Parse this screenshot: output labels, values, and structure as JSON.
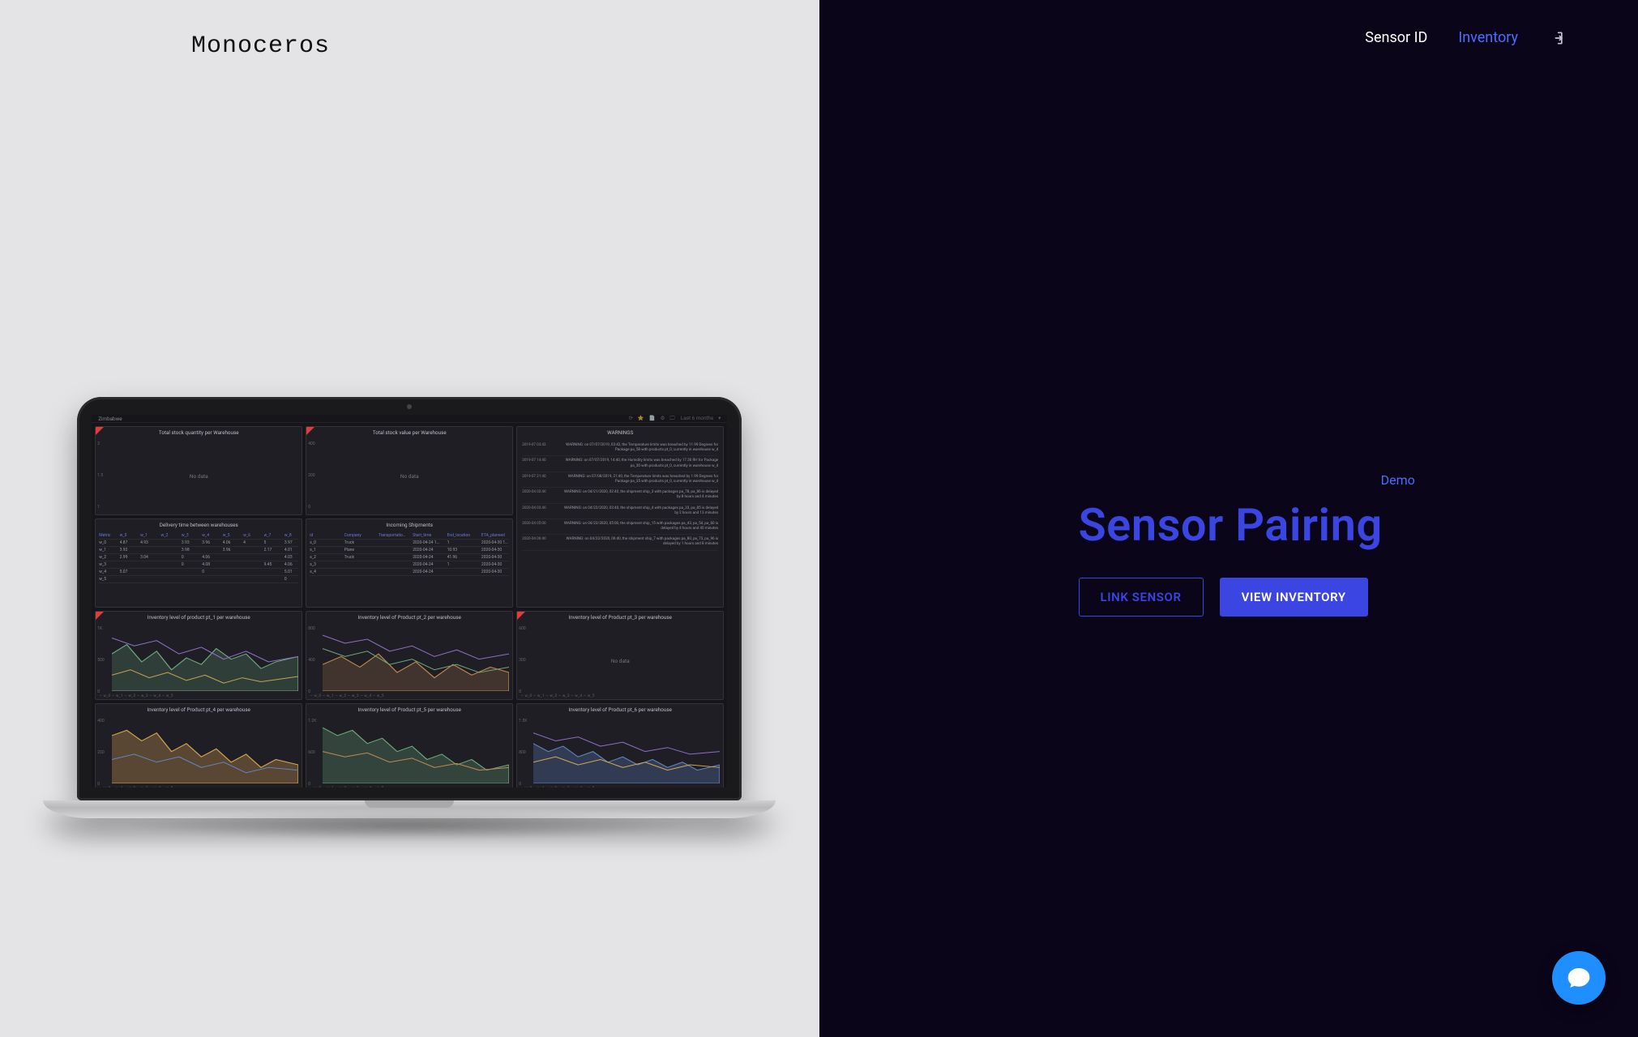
{
  "brand": "Monoceros",
  "nav": {
    "sensor_id": "Sensor ID",
    "inventory": "Inventory"
  },
  "hero": {
    "demo": "Demo",
    "title": "Sensor Pairing",
    "link_sensor": "LINK SENSOR",
    "view_inventory": "VIEW INVENTORY"
  },
  "dashboard": {
    "topbar": {
      "title": "Zimbabwe",
      "timerange": "Last 6 months"
    },
    "no_data_label": "No data",
    "cards": {
      "stock_qty": "Total stock quantity per Warehouse",
      "stock_value": "Total stock value per Warehouse",
      "warnings": "WARNINGS",
      "delivery": "Delivery time between warehouses",
      "incoming": "Incoming Shipments",
      "inv_a1": "Inventory level of product pt_1 per warehouse",
      "inv_a2": "Inventory level of Product pt_2 per warehouse",
      "inv_a3": "Inventory level of Product pt_3 per warehouse",
      "inv_b1": "Inventory level of Product pt_4 per warehouse",
      "inv_b2": "Inventory level of Product pt_5 per warehouse",
      "inv_b3": "Inventory level of Product pt_6 per warehouse"
    },
    "delivery_table": {
      "headers": [
        "Metric",
        "w_0",
        "w_1",
        "w_2",
        "w_3",
        "w_4",
        "w_5",
        "w_6",
        "w_7",
        "w_8"
      ],
      "rows": [
        [
          "w_0",
          "4.87",
          "4.93",
          "",
          "3.93",
          "3.96",
          "4.06",
          "4",
          "5",
          "3.97"
        ],
        [
          "w_1",
          "3.92",
          "",
          "",
          "3.98",
          "",
          "3.96",
          "",
          "2.17",
          "4.01"
        ],
        [
          "w_2",
          "2.99",
          "3.04",
          "",
          "0",
          "4.06",
          "",
          "",
          "",
          "4.03"
        ],
        [
          "w_3",
          "",
          "",
          "",
          "0",
          "4.08",
          "",
          "",
          "9.45",
          "4.06"
        ],
        [
          "w_4",
          "5.07",
          "",
          "",
          "",
          "0",
          "",
          "",
          "",
          "5.01"
        ],
        [
          "w_5",
          "",
          "",
          "",
          "",
          "",
          "",
          "",
          "",
          "0"
        ]
      ]
    },
    "incoming_table": {
      "headers": [
        "id",
        "Company",
        "Transportation_type",
        "Start_time",
        "End_location",
        "ETA_planned"
      ],
      "rows": [
        [
          "s_0",
          "Truck",
          "",
          "2020-04-24 17:00:00",
          "1",
          "2020-04-30 17:00:00"
        ],
        [
          "s_1",
          "Plane",
          "",
          "2020-04-24",
          "10.93",
          "2020-04-30"
        ],
        [
          "s_2",
          "Truck",
          "",
          "2020-04-24",
          "41.96",
          "2020-04-30"
        ],
        [
          "s_3",
          "",
          "",
          "2020-04-24",
          "1",
          "2020-04-30"
        ],
        [
          "s_4",
          "",
          "",
          "2020-04-24",
          "",
          "2020-04-30"
        ]
      ]
    },
    "warnings_log": [
      {
        "ts": "2019-07 03:42",
        "msg": "WARNING: on 07/07/2019, 03:42, the Temperature limits was breached by 11.99 Degrees for Package pa_58 with products pt_0, currently in warehouse w_4"
      },
      {
        "ts": "2019-07 14:40",
        "msg": "WARNING: on 07/07/2019, 14:40, the Humidity limits was breached by 17.36 RH for Package pa_30 with products pt_0, currently in warehouse w_4"
      },
      {
        "ts": "2019-07 21:40",
        "msg": "WARNING: on 07/08/2019, 21:40, the Temperature limits was breached by 1.99 Degrees for Package pa_35 with products pt_0, currently in warehouse w_4"
      },
      {
        "ts": "2020-04 02:40",
        "msg": "WARNING: on 04/21/2020, 02:40, the shipment ship_3 with packages pa_78, pa_86 is delayed by 8 hours and 4 minutes"
      },
      {
        "ts": "2020-04 03:40",
        "msg": "WARNING: on 04/22/2020, 03:40, the shipment ship_4 with packages pa_33, pa_85 is delayed by 2 hours and 13 minutes"
      },
      {
        "ts": "2020-04 05:00",
        "msg": "WARNING: on 04/22/2020, 05:00, the shipment ship_15 with packages pa_43, pa_54, pa_60 is delayed by 4 hours and 40 minutes"
      },
      {
        "ts": "2020-04 06:40",
        "msg": "WARNING: on 04/22/2020, 06:40, the shipment ship_7 with packages pa_80, pa_73, pa_96 is delayed by 1 hours and 8 minutes"
      }
    ],
    "legend": "— w_0 — w_1 — w_2 — w_3 — w_4 — w_5"
  }
}
